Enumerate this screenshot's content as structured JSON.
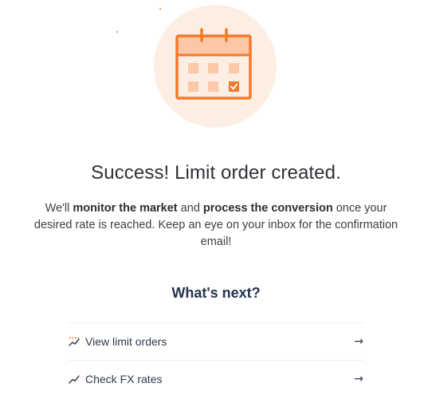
{
  "success": {
    "title": "Success! Limit order created.",
    "description_parts": {
      "p1": "We'll ",
      "b1": "monitor the market",
      "p2": " and ",
      "b2": "process the conversion",
      "p3": " once your desired rate is reached. Keep an eye on your inbox for the confirmation email!"
    }
  },
  "next": {
    "heading": "What's next?",
    "actions": [
      {
        "label": "View limit orders",
        "icon": "limit-orders-icon",
        "arrow": "→"
      },
      {
        "label": "Check FX rates",
        "icon": "trend-chart-icon",
        "arrow": "→"
      }
    ]
  },
  "colors": {
    "accent": "#f47a2a",
    "accent_light": "#fdeee4",
    "heading_navy": "#23354d"
  }
}
